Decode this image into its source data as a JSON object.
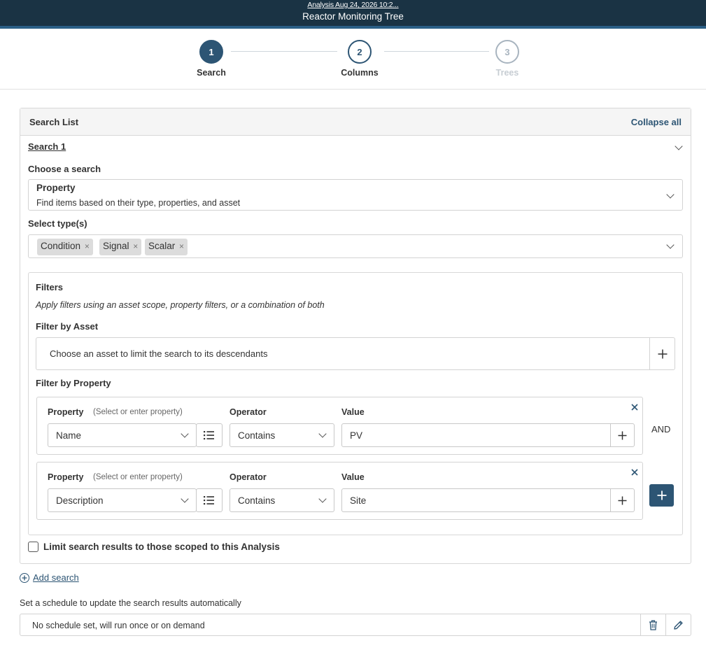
{
  "header": {
    "analysis_link": "Analysis Aug 24, 2026 10:2...",
    "title": "Reactor Monitoring Tree"
  },
  "stepper": {
    "steps": [
      {
        "number": "1",
        "label": "Search",
        "state": "active"
      },
      {
        "number": "2",
        "label": "Columns",
        "state": "next"
      },
      {
        "number": "3",
        "label": "Trees",
        "state": "disabled"
      }
    ]
  },
  "search_list": {
    "title": "Search List",
    "collapse_all": "Collapse all",
    "search": {
      "title": "Search 1",
      "choose_label": "Choose a search",
      "selected_search": {
        "name": "Property",
        "description": "Find items based on their type, properties, and asset"
      },
      "types_label": "Select type(s)",
      "types": [
        "Condition",
        "Signal",
        "Scalar"
      ],
      "tag_remove": "×",
      "filters": {
        "title": "Filters",
        "hint": "Apply filters using an asset scope, property filters, or a combination of both",
        "asset_label": "Filter by Asset",
        "asset_placeholder": "Choose an asset to limit the search to its descendants",
        "property_label": "Filter by Property",
        "column_property": "Property",
        "column_property_hint": "(Select or enter property)",
        "column_operator": "Operator",
        "column_value": "Value",
        "rows": [
          {
            "property": "Name",
            "operator": "Contains",
            "value": "PV"
          },
          {
            "property": "Description",
            "operator": "Contains",
            "value": "Site"
          }
        ],
        "conjunction": "AND"
      },
      "limit_label": "Limit search results to those scoped to this Analysis",
      "limit_checked": false
    }
  },
  "add_search": "Add search",
  "schedule": {
    "label": "Set a schedule to update the search results automatically",
    "value": "No schedule set, will run once or on demand"
  },
  "colors": {
    "header_bg": "#1a3344",
    "accent": "#2d5574"
  },
  "icons": {
    "close": "close-icon",
    "plus": "plus-icon",
    "list": "list-icon",
    "trash": "trash-icon",
    "pencil": "pencil-icon",
    "chevron": "chevron-down-icon"
  }
}
